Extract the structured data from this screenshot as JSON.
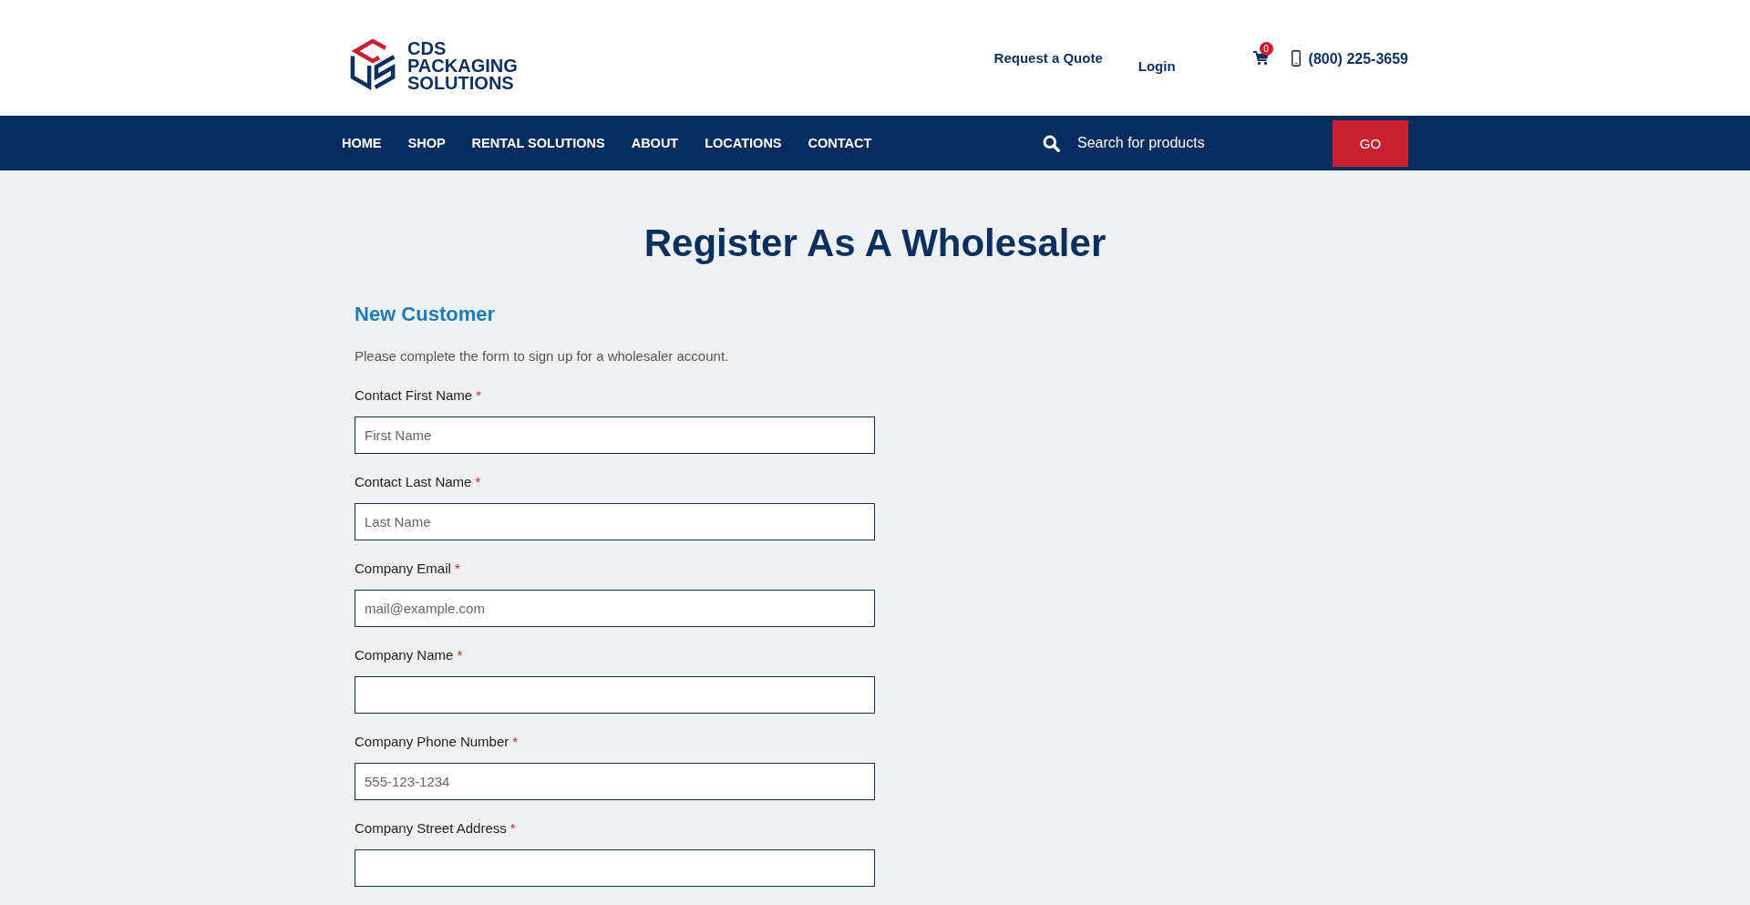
{
  "header": {
    "logo": {
      "lines": [
        "CDS",
        "PACKAGING",
        "SOLUTIONS"
      ]
    },
    "quote_link": "Request a Quote",
    "login_link": "Login",
    "cart": {
      "count": "0"
    },
    "phone": "(800) 225-3659"
  },
  "nav": {
    "items": [
      {
        "label": "HOME"
      },
      {
        "label": "SHOP"
      },
      {
        "label": "RENTAL SOLUTIONS"
      },
      {
        "label": "ABOUT"
      },
      {
        "label": "LOCATIONS"
      },
      {
        "label": "CONTACT"
      }
    ],
    "search": {
      "placeholder": "Search for products",
      "button": "GO"
    }
  },
  "main": {
    "title": "Register As A Wholesaler",
    "section": {
      "heading": "New Customer",
      "description": "Please complete the form to sign up for a wholesaler account.",
      "fields": [
        {
          "label": "Contact First Name",
          "required_mark": "*",
          "placeholder": "First Name"
        },
        {
          "label": "Contact Last Name",
          "required_mark": "*",
          "placeholder": "Last Name"
        },
        {
          "label": "Company Email",
          "required_mark": "*",
          "placeholder": "mail@example.com"
        },
        {
          "label": "Company Name",
          "required_mark": "*"
        },
        {
          "label": "Company Phone Number",
          "required_mark": "*",
          "placeholder": "555-123-1234"
        },
        {
          "label": "Company Street Address",
          "required_mark": "*"
        }
      ]
    }
  }
}
